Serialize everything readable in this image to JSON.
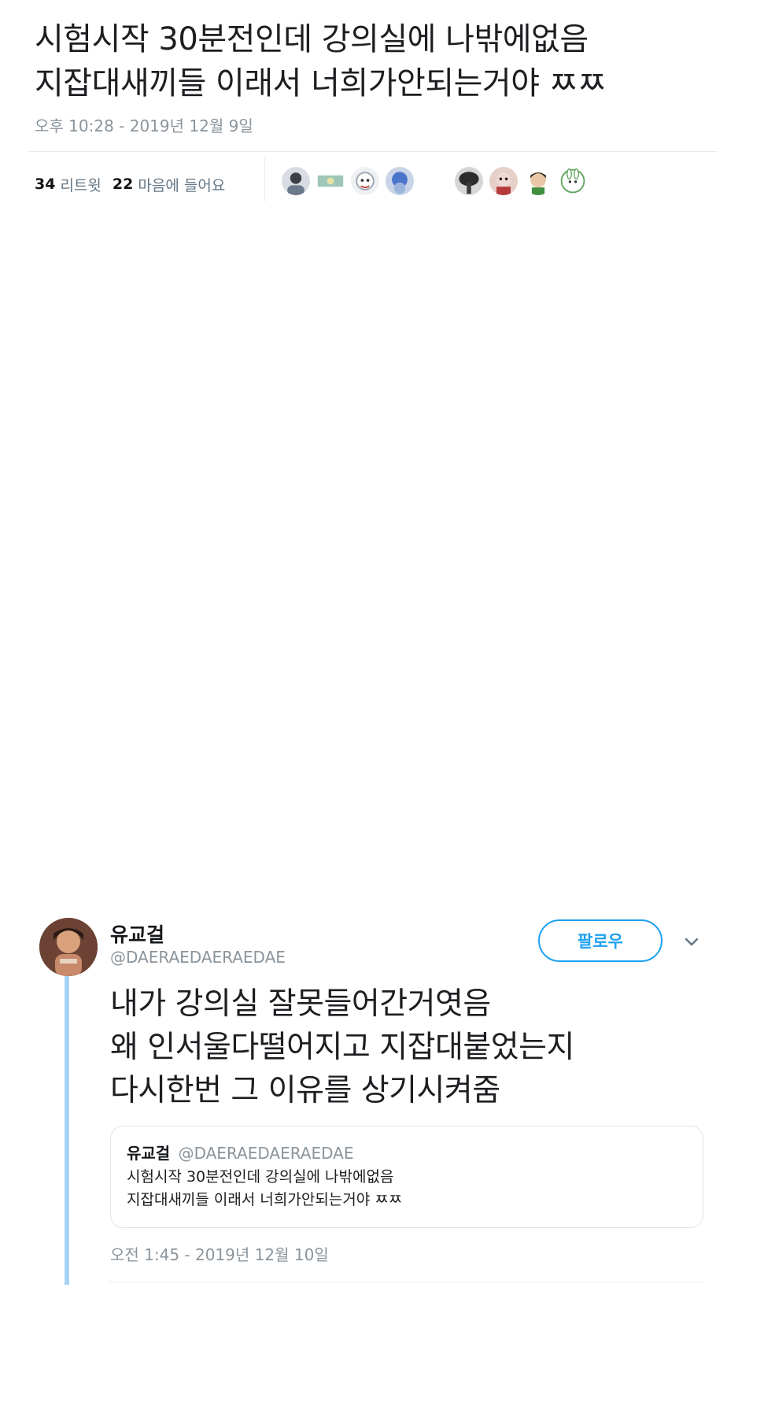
{
  "tweet": {
    "lines": [
      "시험시작 30분전인데 강의실에 나밖에없음",
      "지잡대새끼들 이래서 너희가안되는거야 ㅉㅉ"
    ],
    "timestamp": "오후 10:28 - 2019년 12월 9일",
    "retweet_count": "34",
    "retweet_label": "리트윗",
    "like_count": "22",
    "like_label": "마음에 들어요"
  },
  "reply": {
    "user_name": "유교걸",
    "user_handle": "@DAERAEDAERAEDAE",
    "follow_label": "팔로우",
    "lines": [
      "내가 강의실 잘못들어간거엿음",
      "왜 인서울다떨어지고 지잡대붙었는지",
      "다시한번 그 이유를 상기시켜줌"
    ],
    "quote": {
      "user_name": "유교걸",
      "user_handle": "@DAERAEDAERAEDAE",
      "lines": [
        "시험시작 30분전인데 강의실에 나밖에없음",
        "지잡대새끼들 이래서 너희가안되는거야 ㅉㅉ"
      ]
    },
    "timestamp": "오전 1:45 - 2019년 12월 10일"
  },
  "icons": {
    "menu": "chevron-down-icon"
  },
  "colors": {
    "accent": "#1da1f2",
    "thread_line": "#a6d3f5",
    "muted_text": "#8a949c"
  }
}
